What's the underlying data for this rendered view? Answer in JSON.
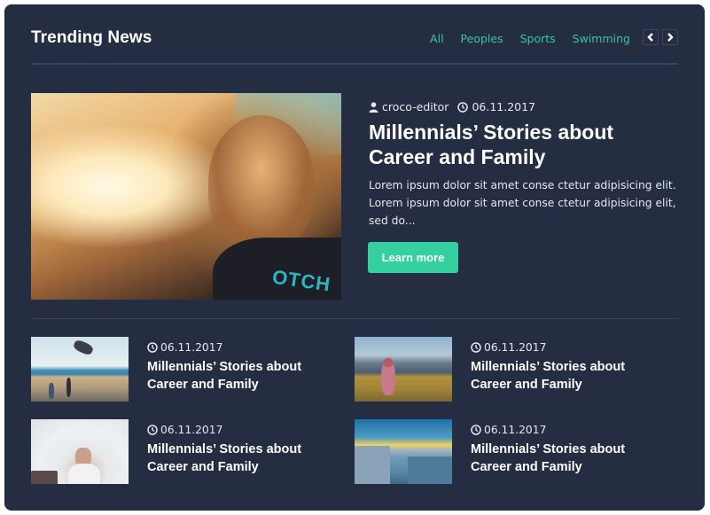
{
  "widget": {
    "title": "Trending News",
    "filters": [
      {
        "label": "All"
      },
      {
        "label": "Peoples"
      },
      {
        "label": "Sports"
      },
      {
        "label": "Swimming"
      }
    ],
    "nav": {
      "prev_icon": "chevron-left-icon",
      "next_icon": "chevron-right-icon"
    }
  },
  "colors": {
    "background": "#252d42",
    "accent": "#35d0a0",
    "filter_text": "#35c99b",
    "divider": "#334466"
  },
  "featured": {
    "author": "croco-editor",
    "author_icon": "user-icon",
    "date": "06.11.2017",
    "date_icon": "clock-icon",
    "title": "Millennials’ Stories about Career and Family",
    "excerpt": "Lorem ipsum dolor sit amet conse ctetur adipisicing elit. Lorem ipsum dolor sit amet conse ctetur adipisicing elit, sed do...",
    "button_label": "Learn more",
    "image_alt": "woman with windblown hair at sunset"
  },
  "items": [
    {
      "date": "06.11.2017",
      "title": "Millennials’ Stories about Career and Family",
      "image_alt": "skateboarder jumping at the beach"
    },
    {
      "date": "06.11.2017",
      "title": "Millennials’ Stories about Career and Family",
      "image_alt": "girl sitting on a mountain meadow"
    },
    {
      "date": "06.11.2017",
      "title": "Millennials’ Stories about Career and Family",
      "image_alt": "woman under a white sheet"
    },
    {
      "date": "06.11.2017",
      "title": "Millennials’ Stories about Career and Family",
      "image_alt": "city skyline at sunrise"
    }
  ]
}
